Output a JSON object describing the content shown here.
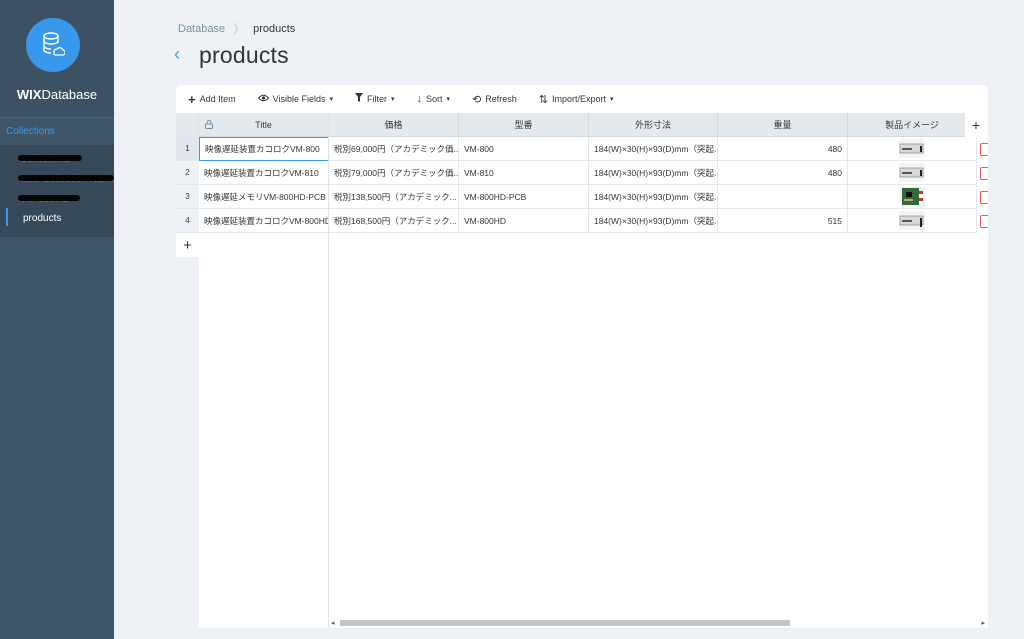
{
  "app": {
    "brand_bold": "WIX",
    "brand_rest": "Database",
    "collections_label": "Collections",
    "collections": [
      {
        "label": "Collection1",
        "redacted": true
      },
      {
        "label": "New Collection Name",
        "redacted": true
      },
      {
        "label": "VM-800HD",
        "redacted": true
      },
      {
        "label": "products",
        "redacted": false,
        "active": true
      }
    ]
  },
  "header": {
    "breadcrumb_root": "Database",
    "breadcrumb_sep": "〉",
    "breadcrumb_current": "products",
    "title": "products",
    "back_glyph": "‹"
  },
  "toolbar": {
    "add_item": "Add Item",
    "visible_fields": "Visible Fields",
    "filter": "Filter",
    "sort": "Sort",
    "refresh": "Refresh",
    "import_export": "Import/Export"
  },
  "table": {
    "columns": [
      "Title",
      "価格",
      "型番",
      "外形寸法",
      "重量",
      "製品イメージ"
    ],
    "rows": [
      {
        "num": "1",
        "title": "映像遅延装置カコロクVM-800",
        "price": "税別69,000円（アカデミック価...",
        "model": "VM-800",
        "size": "184(W)×30(H)×93(D)mm（突起...",
        "weight": "480",
        "image": "device"
      },
      {
        "num": "2",
        "title": "映像遅延装置カコロクVM-810",
        "price": "税別79,000円（アカデミック価...",
        "model": "VM-810",
        "size": "184(W)×30(H)×93(D)mm（突起...",
        "weight": "480",
        "image": "device"
      },
      {
        "num": "3",
        "title": "映像遅延メモリVM-800HD-PCB",
        "price": "税別138,500円（アカデミック...",
        "model": "VM-800HD-PCB",
        "size": "184(W)×30(H)×93(D)mm（突起...",
        "weight": "",
        "image": "pcb"
      },
      {
        "num": "4",
        "title": "映像遅延装置カコロクVM-800HD",
        "price": "税別168,500円（アカデミック...",
        "model": "VM-800HD",
        "size": "184(W)×30(H)×93(D)mm（突起...",
        "weight": "515",
        "image": "device"
      }
    ]
  },
  "icons": {
    "lock": "🔒",
    "plus": "+",
    "eye": "◉",
    "filter": "▼",
    "sort": "↓",
    "refresh": "⟲",
    "import": "⇅",
    "caret": "▾",
    "scroll_left": "◂",
    "scroll_right": "▸"
  },
  "colors": {
    "accent": "#3899ec",
    "sidebar": "#3f5669",
    "danger": "#ee5951"
  }
}
